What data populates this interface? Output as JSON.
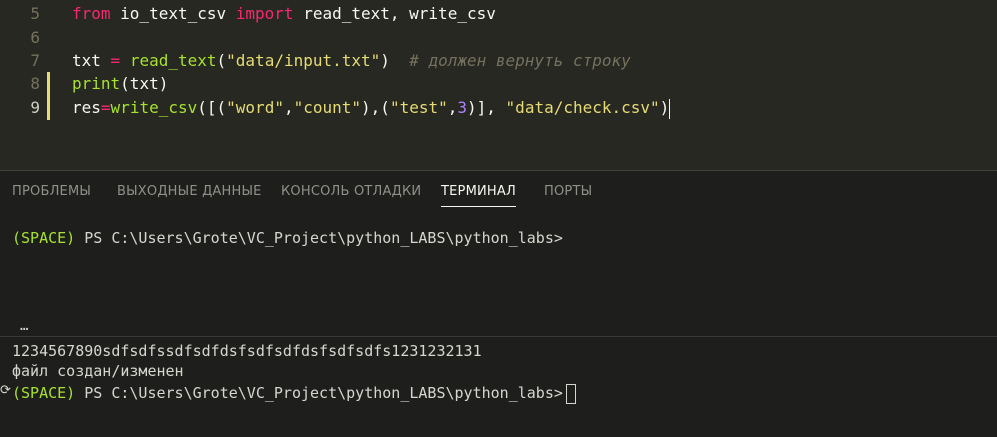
{
  "editor": {
    "lines": [
      {
        "num": "5",
        "tokens": [
          [
            "kw",
            "from"
          ],
          [
            "plain",
            " io_text_csv "
          ],
          [
            "kw",
            "import"
          ],
          [
            "plain",
            " read_text, write_csv"
          ]
        ]
      },
      {
        "num": "6",
        "tokens": []
      },
      {
        "num": "7",
        "tokens": [
          [
            "plain",
            "txt "
          ],
          [
            "op",
            "="
          ],
          [
            "plain",
            " "
          ],
          [
            "fn",
            "read_text"
          ],
          [
            "plain",
            "("
          ],
          [
            "str",
            "\"data/input.txt\""
          ],
          [
            "plain",
            ")  "
          ],
          [
            "cmt",
            "# должен вернуть строку"
          ]
        ]
      },
      {
        "num": "8",
        "tokens": [
          [
            "fn",
            "print"
          ],
          [
            "plain",
            "(txt)"
          ]
        ]
      },
      {
        "num": "9",
        "tokens": [
          [
            "plain",
            "res"
          ],
          [
            "op",
            "="
          ],
          [
            "fn",
            "write_csv"
          ],
          [
            "plain",
            "([("
          ],
          [
            "str",
            "\"word\""
          ],
          [
            "plain",
            ","
          ],
          [
            "str",
            "\"count\""
          ],
          [
            "plain",
            "),("
          ],
          [
            "str",
            "\"test\""
          ],
          [
            "plain",
            ","
          ],
          [
            "num",
            "3"
          ],
          [
            "plain",
            ")], "
          ],
          [
            "str",
            "\"data/check.csv\""
          ],
          [
            "plain",
            ")"
          ]
        ]
      }
    ],
    "modified_color": "#e6db74"
  },
  "panel": {
    "tabs": [
      {
        "label": "ПРОБЛЕМЫ",
        "active": false
      },
      {
        "label": "ВЫХОДНЫЕ ДАННЫЕ",
        "active": false
      },
      {
        "label": "КОНСОЛЬ ОТЛАДКИ",
        "active": false
      },
      {
        "label": "ТЕРМИНАЛ",
        "active": true
      },
      {
        "label": "ПОРТЫ",
        "active": false
      }
    ],
    "terminal": {
      "prompt_env": "(SPACE)",
      "prompt_path": " PS C:\\Users\\Grote\\VC_Project\\python_LABS\\python_labs>",
      "ellipsis": "…",
      "output_line1": "1234567890sdfsdfssdfsdfdsfsdfsdfdsfsdfsdfs1231232131",
      "output_line2": "файл создан/изменен",
      "prompt_arrow": "⟳"
    }
  }
}
